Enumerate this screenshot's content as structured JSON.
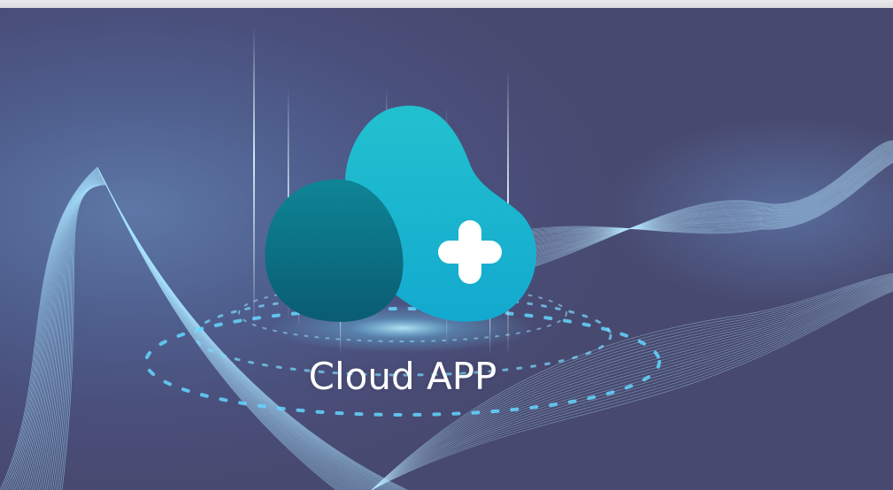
{
  "app": {
    "title": "Cloud APP"
  },
  "logo": {
    "icon": "cloud-plus-icon",
    "colors": {
      "dark_teal": "#0d6d82",
      "cyan": "#1bb6cc",
      "plus": "#ffffff"
    }
  },
  "background": {
    "base_color": "#4a4f7b",
    "accent_color": "#63c9ff"
  }
}
